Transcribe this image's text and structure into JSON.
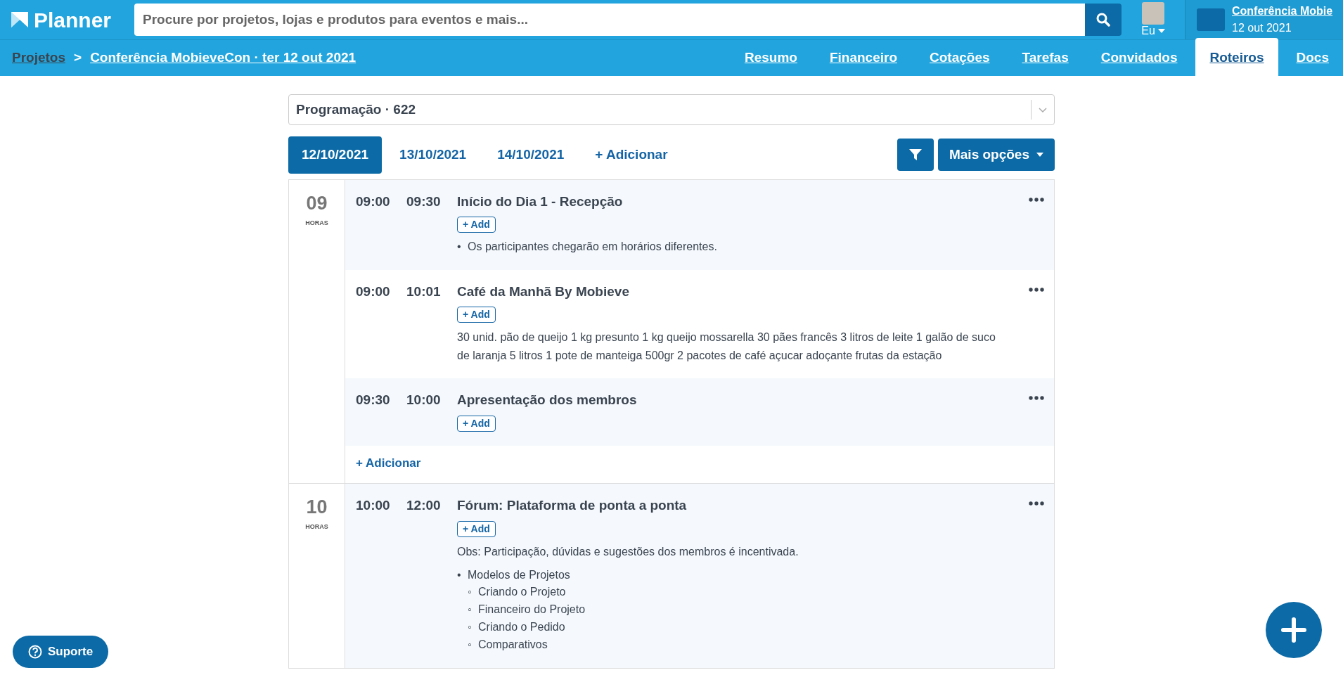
{
  "header": {
    "logo": "Planner",
    "search": {
      "placeholder": "Procure por projetos, lojas e produtos para eventos e mais..."
    },
    "user": {
      "label": "Eu"
    },
    "project": {
      "title": "Conferência Mobie",
      "date": "12 out 2021"
    }
  },
  "breadcrumb": [
    {
      "label": "Projetos"
    },
    {
      "label": "Conferência MobieveCon · ter 12 out 2021"
    }
  ],
  "breadcrumb_separator": ">",
  "nav_tabs": [
    {
      "label": "Resumo",
      "selected": false
    },
    {
      "label": "Financeiro",
      "selected": false
    },
    {
      "label": "Cotações",
      "selected": false
    },
    {
      "label": "Tarefas",
      "selected": false
    },
    {
      "label": "Convidados",
      "selected": false
    },
    {
      "label": "Roteiros",
      "selected": true
    },
    {
      "label": "Docs",
      "selected": false
    }
  ],
  "schedule_select": {
    "value": "Programação · 622"
  },
  "date_tabs": [
    {
      "label": "12/10/2021",
      "selected": true
    },
    {
      "label": "13/10/2021",
      "selected": false
    },
    {
      "label": "14/10/2021",
      "selected": false
    }
  ],
  "add_date": "+ Adicionar",
  "more_options": "Mais opções",
  "hour_groups": [
    {
      "hour": "09",
      "unit": "HORAS",
      "add_event": "+ Adicionar",
      "events": [
        {
          "start": "09:00",
          "end": "09:30",
          "title": "Início do Dia 1 - Recepção",
          "add": "+ Add",
          "body": [
            {
              "kind": "list",
              "items": [
                {
                  "marker": "•",
                  "text": "Os participantes chegarão em horários diferentes."
                }
              ]
            }
          ]
        },
        {
          "start": "09:00",
          "end": "10:01",
          "title": "Café da Manhã By Mobieve",
          "add": "+ Add",
          "body": [
            {
              "kind": "paragraph",
              "text": "30 unid. pão de queijo 1 kg presunto 1 kg queijo mossarella 30 pães francês 3 litros de leite 1 galão de suco de laranja 5 litros 1 pote de manteiga 500gr 2 pacotes de café açucar adoçante frutas da estação"
            }
          ]
        },
        {
          "start": "09:30",
          "end": "10:00",
          "title": "Apresentação dos membros",
          "add": "+ Add"
        }
      ]
    },
    {
      "hour": "10",
      "unit": "HORAS",
      "events": [
        {
          "start": "10:00",
          "end": "12:00",
          "title": "Fórum: Plataforma de ponta a ponta",
          "add": "+ Add",
          "body": [
            {
              "kind": "paragraph",
              "text": "Obs: Participação, dúvidas e sugestões dos membros é incentivada."
            },
            {
              "kind": "list",
              "items": [
                {
                  "marker": "•",
                  "text": "Modelos de Projetos",
                  "children": [
                    {
                      "marker": "◦",
                      "text": "Criando o Projeto"
                    },
                    {
                      "marker": "◦",
                      "text": "Financeiro do Projeto"
                    },
                    {
                      "marker": "◦",
                      "text": "Criando o Pedido"
                    },
                    {
                      "marker": "◦",
                      "text": "Comparativos"
                    }
                  ]
                }
              ]
            }
          ]
        }
      ]
    }
  ],
  "support_button": "Suporte"
}
